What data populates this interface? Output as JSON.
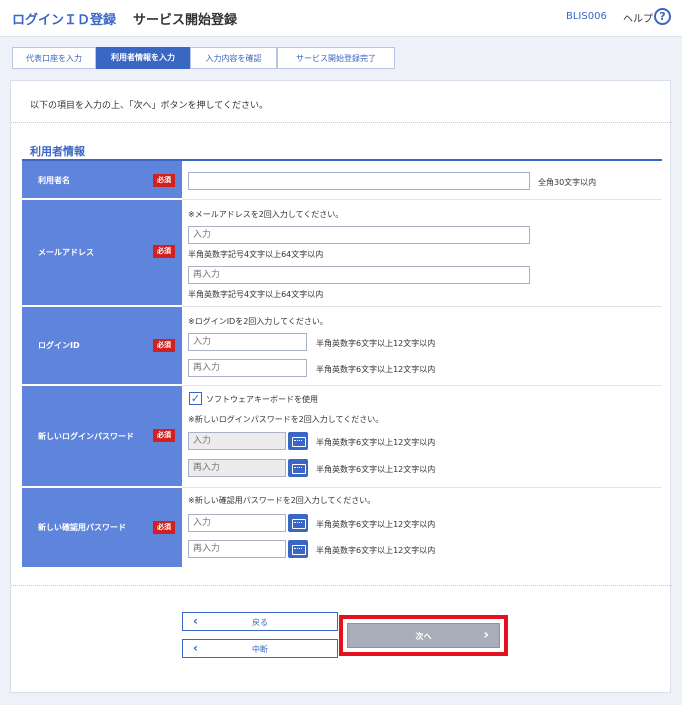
{
  "header": {
    "app_title": "ログインＩＤ登録",
    "page_title": "サービス開始登録",
    "screen_id": "BLIS006",
    "help_label": "ヘルプ",
    "help_icon": "?"
  },
  "steps": [
    "代表口座を入力",
    "利用者情報を入力",
    "入力内容を確認",
    "サービス開始登録完了"
  ],
  "intro_text": "以下の項目を入力の上、「次へ」ボタンを押してください。",
  "section_title": "利用者情報",
  "required_label": "必須",
  "user_name": {
    "label": "利用者名",
    "value": "",
    "note": "全角30文字以内"
  },
  "email": {
    "label": "メールアドレス",
    "instruction": "※メールアドレスを2回入力してください。",
    "input_placeholder": "入力",
    "reenter_placeholder": "再入力",
    "note1": "半角英数字記号4文字以上64文字以内",
    "note2": "半角英数字記号4文字以上64文字以内"
  },
  "login_id": {
    "label": "ログインID",
    "instruction": "※ログインIDを2回入力してください。",
    "input_placeholder": "入力",
    "reenter_placeholder": "再入力",
    "note1": "半角英数字6文字以上12文字以内",
    "note2": "半角英数字6文字以上12文字以内"
  },
  "login_password": {
    "label": "新しいログインパスワード",
    "software_keyboard_label": "ソフトウェアキーボードを使用",
    "software_keyboard_checked": true,
    "instruction": "※新しいログインパスワードを2回入力してください。",
    "input_placeholder": "入力",
    "reenter_placeholder": "再入力",
    "note1": "半角英数字6文字以上12文字以内",
    "note2": "半角英数字6文字以上12文字以内"
  },
  "confirm_password": {
    "label": "新しい確認用パスワード",
    "instruction": "※新しい確認用パスワードを2回入力してください。",
    "input_placeholder": "入力",
    "reenter_placeholder": "再入力",
    "note1": "半角英数字6文字以上12文字以内",
    "note2": "半角英数字6文字以上12文字以内"
  },
  "buttons": {
    "back": "戻る",
    "suspend": "中断",
    "next": "次へ"
  },
  "colors": {
    "accent": "#3a66c4",
    "label_bg": "#5f84dc",
    "required": "#d21f1f",
    "highlight": "#e2131e"
  }
}
